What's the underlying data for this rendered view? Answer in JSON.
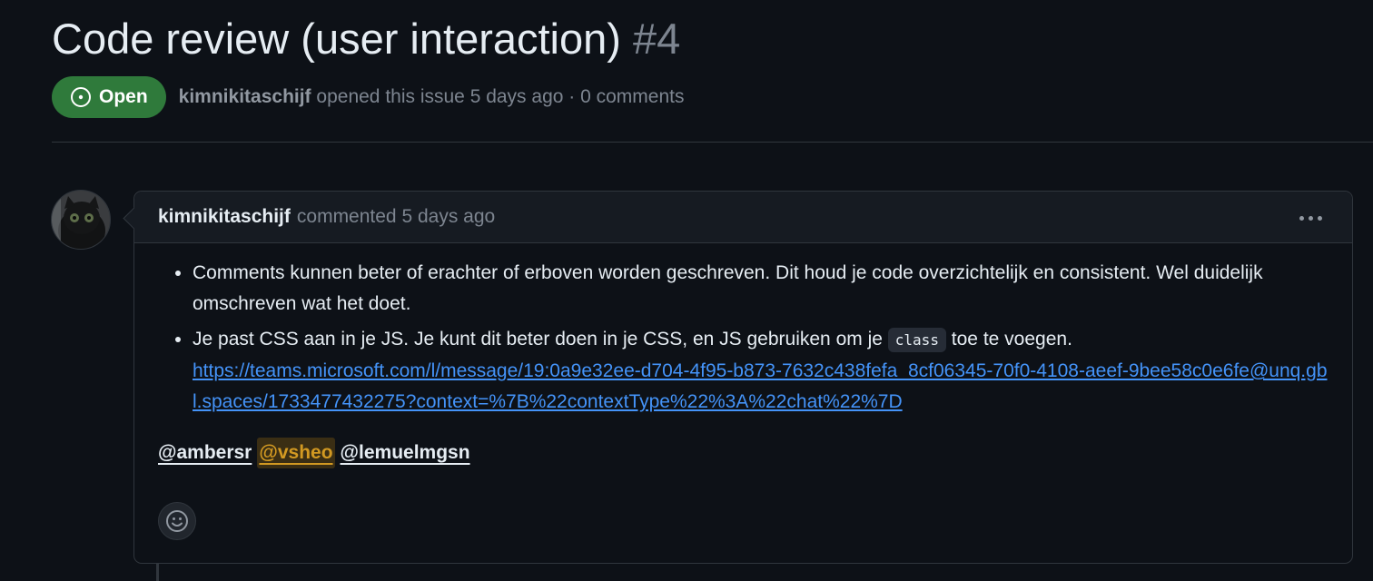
{
  "issue": {
    "title": "Code review (user interaction)",
    "number": "#4",
    "state": "Open",
    "author": "kimnikitaschijf",
    "opened_text": "opened this issue 5 days ago · 0 comments"
  },
  "comment": {
    "author": "kimnikitaschijf",
    "time": "commented 5 days ago",
    "bullets": [
      {
        "text": "Comments kunnen beter of erachter of erboven worden geschreven. Dit houd je code overzichtelijk en consistent. Wel duidelijk omschreven wat het doet."
      },
      {
        "text_before": "Je past CSS aan in je JS. Je kunt dit beter doen in je CSS, en JS gebruiken om je",
        "code": "class",
        "text_after": "toe te voegen.",
        "link": "https://teams.microsoft.com/l/message/19:0a9e32ee-d704-4f95-b873-7632c438fefa_8cf06345-70f0-4108-aeef-9bee58c0e6fe@unq.gbl.spaces/1733477432275?context=%7B%22contextType%22%3A%22chat%22%7D"
      }
    ],
    "mentions": [
      "@ambersr",
      "@vsheo",
      "@lemuelmgsn"
    ]
  },
  "icons": {
    "state": "issue-opened-icon",
    "menu": "kebab-horizontal-icon",
    "reaction": "smiley-icon"
  },
  "colors": {
    "open_badge": "#2f7a3b",
    "link": "#4493f8",
    "self_mention": "#d29922"
  }
}
